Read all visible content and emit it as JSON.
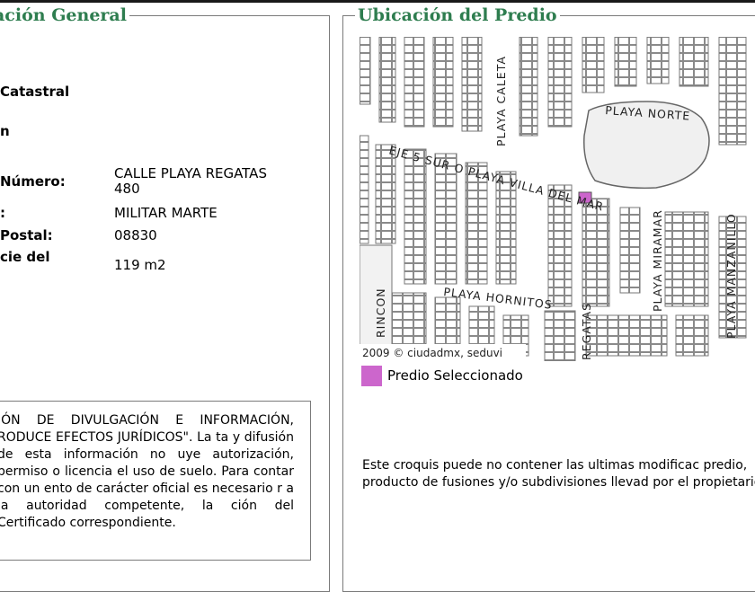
{
  "left_panel": {
    "title": "ación General",
    "fields": [
      {
        "label": "Catastral",
        "value": ""
      },
      {
        "label": "n",
        "value": ""
      },
      {
        "label": "Número:",
        "value": "CALLE PLAYA REGATAS 480"
      },
      {
        "label": ":",
        "value": "MILITAR MARTE"
      },
      {
        "label": "Postal:",
        "value": "08830"
      },
      {
        "label": "cie del",
        "value": "119 m2"
      }
    ],
    "disclaimer": "IÓN DE DIVULGACIÓN E INFORMACIÓN, RODUCE EFECTOS JURÍDICOS\". La ta y difusión de esta información no uye autorización, permiso o licencia el uso de suelo. Para contar con un ento de carácter oficial es necesario r a la autoridad competente, la ción del Certificado correspondiente."
  },
  "right_panel": {
    "title": "Ubicación del Predio",
    "map": {
      "copyright": "2009 © ciudadmx, seduvi",
      "street_labels": [
        "PLAYA CALETA",
        "PLAYA NORTE",
        "EJE 5 SUR O PLAYA VILLA DEL MAR",
        "PLAYA MIRAMAR",
        "PLAYA MANZANILLO",
        "PLAYA HORNITOS",
        "RINCON",
        "REGATAS"
      ],
      "highlight_color": "#cc66cc"
    },
    "legend_label": "Predio Seleccionado",
    "note": "Este croquis puede no contener las ultimas modificac predio, producto de fusiones y/o subdivisiones llevad por el propietario."
  }
}
